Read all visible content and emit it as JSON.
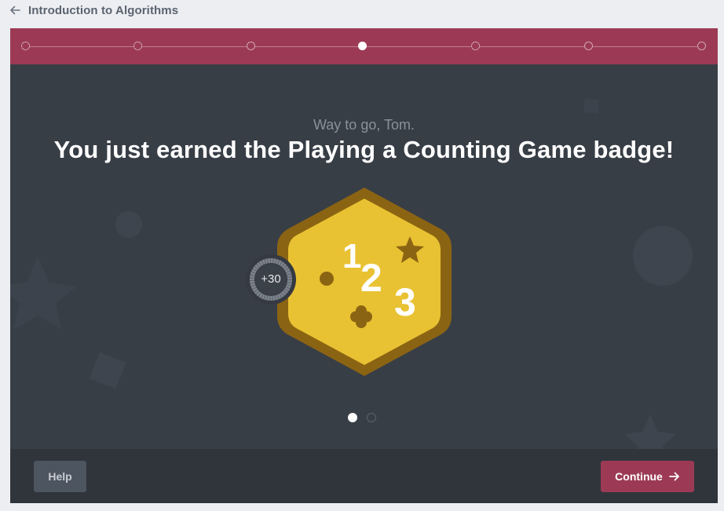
{
  "header": {
    "title": "Introduction to Algorithms",
    "back_icon": "arrow-left-icon"
  },
  "progress": {
    "steps": [
      {
        "state": "dotted"
      },
      {
        "state": "dotted"
      },
      {
        "state": "hollow"
      },
      {
        "state": "current"
      },
      {
        "state": "dotted"
      },
      {
        "state": "hollow"
      },
      {
        "state": "hollow"
      }
    ],
    "current_step": 4,
    "total_steps": 7
  },
  "celebration": {
    "greeting": "Way to go, Tom.",
    "headline": "You just earned the Playing a Counting Game badge!"
  },
  "badge": {
    "name": "Playing a Counting Game",
    "numerals": [
      "1",
      "2",
      "3"
    ],
    "points_label": "+30",
    "colors": {
      "fill": "#e9c233",
      "border": "#8b6413",
      "glyphs": "#8b6413"
    }
  },
  "pager": {
    "count": 2,
    "active": 1
  },
  "footer": {
    "help_label": "Help",
    "continue_label": "Continue",
    "continue_icon": "arrow-right-icon"
  },
  "colors": {
    "accent": "#9c3a56",
    "card": "#383e46",
    "footer": "#30353c",
    "page": "#eceef1"
  }
}
